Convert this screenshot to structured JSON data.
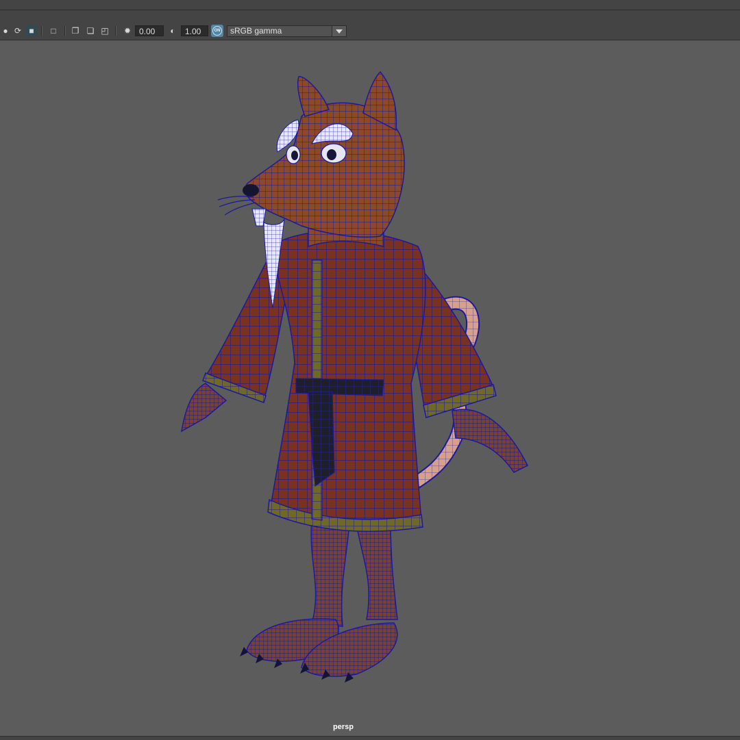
{
  "toolbar": {
    "exposure_value": "0.00",
    "gamma_value": "1.00",
    "color_management_badge": "ON",
    "view_transform": "sRGB gamma"
  },
  "viewport": {
    "camera_label": "persp"
  },
  "colors": {
    "viewport_bg": "#5c5c5c",
    "robe": "#7a3220",
    "fur": "#8a4a2a",
    "trim": "#6f6826",
    "belt": "#1e1e2a",
    "wire": "#1a1a9a",
    "tail": "#d8a08a"
  },
  "icons": [
    "isolate-icon",
    "xray-icon",
    "backface-icon",
    "wireframe-on-shaded-icon",
    "select-highlight-icon",
    "resolution-gate-icon",
    "safe-area-icon",
    "film-gate-icon",
    "exposure-icon",
    "gamma-icon",
    "color-management-icon",
    "dropdown-arrow-icon"
  ]
}
